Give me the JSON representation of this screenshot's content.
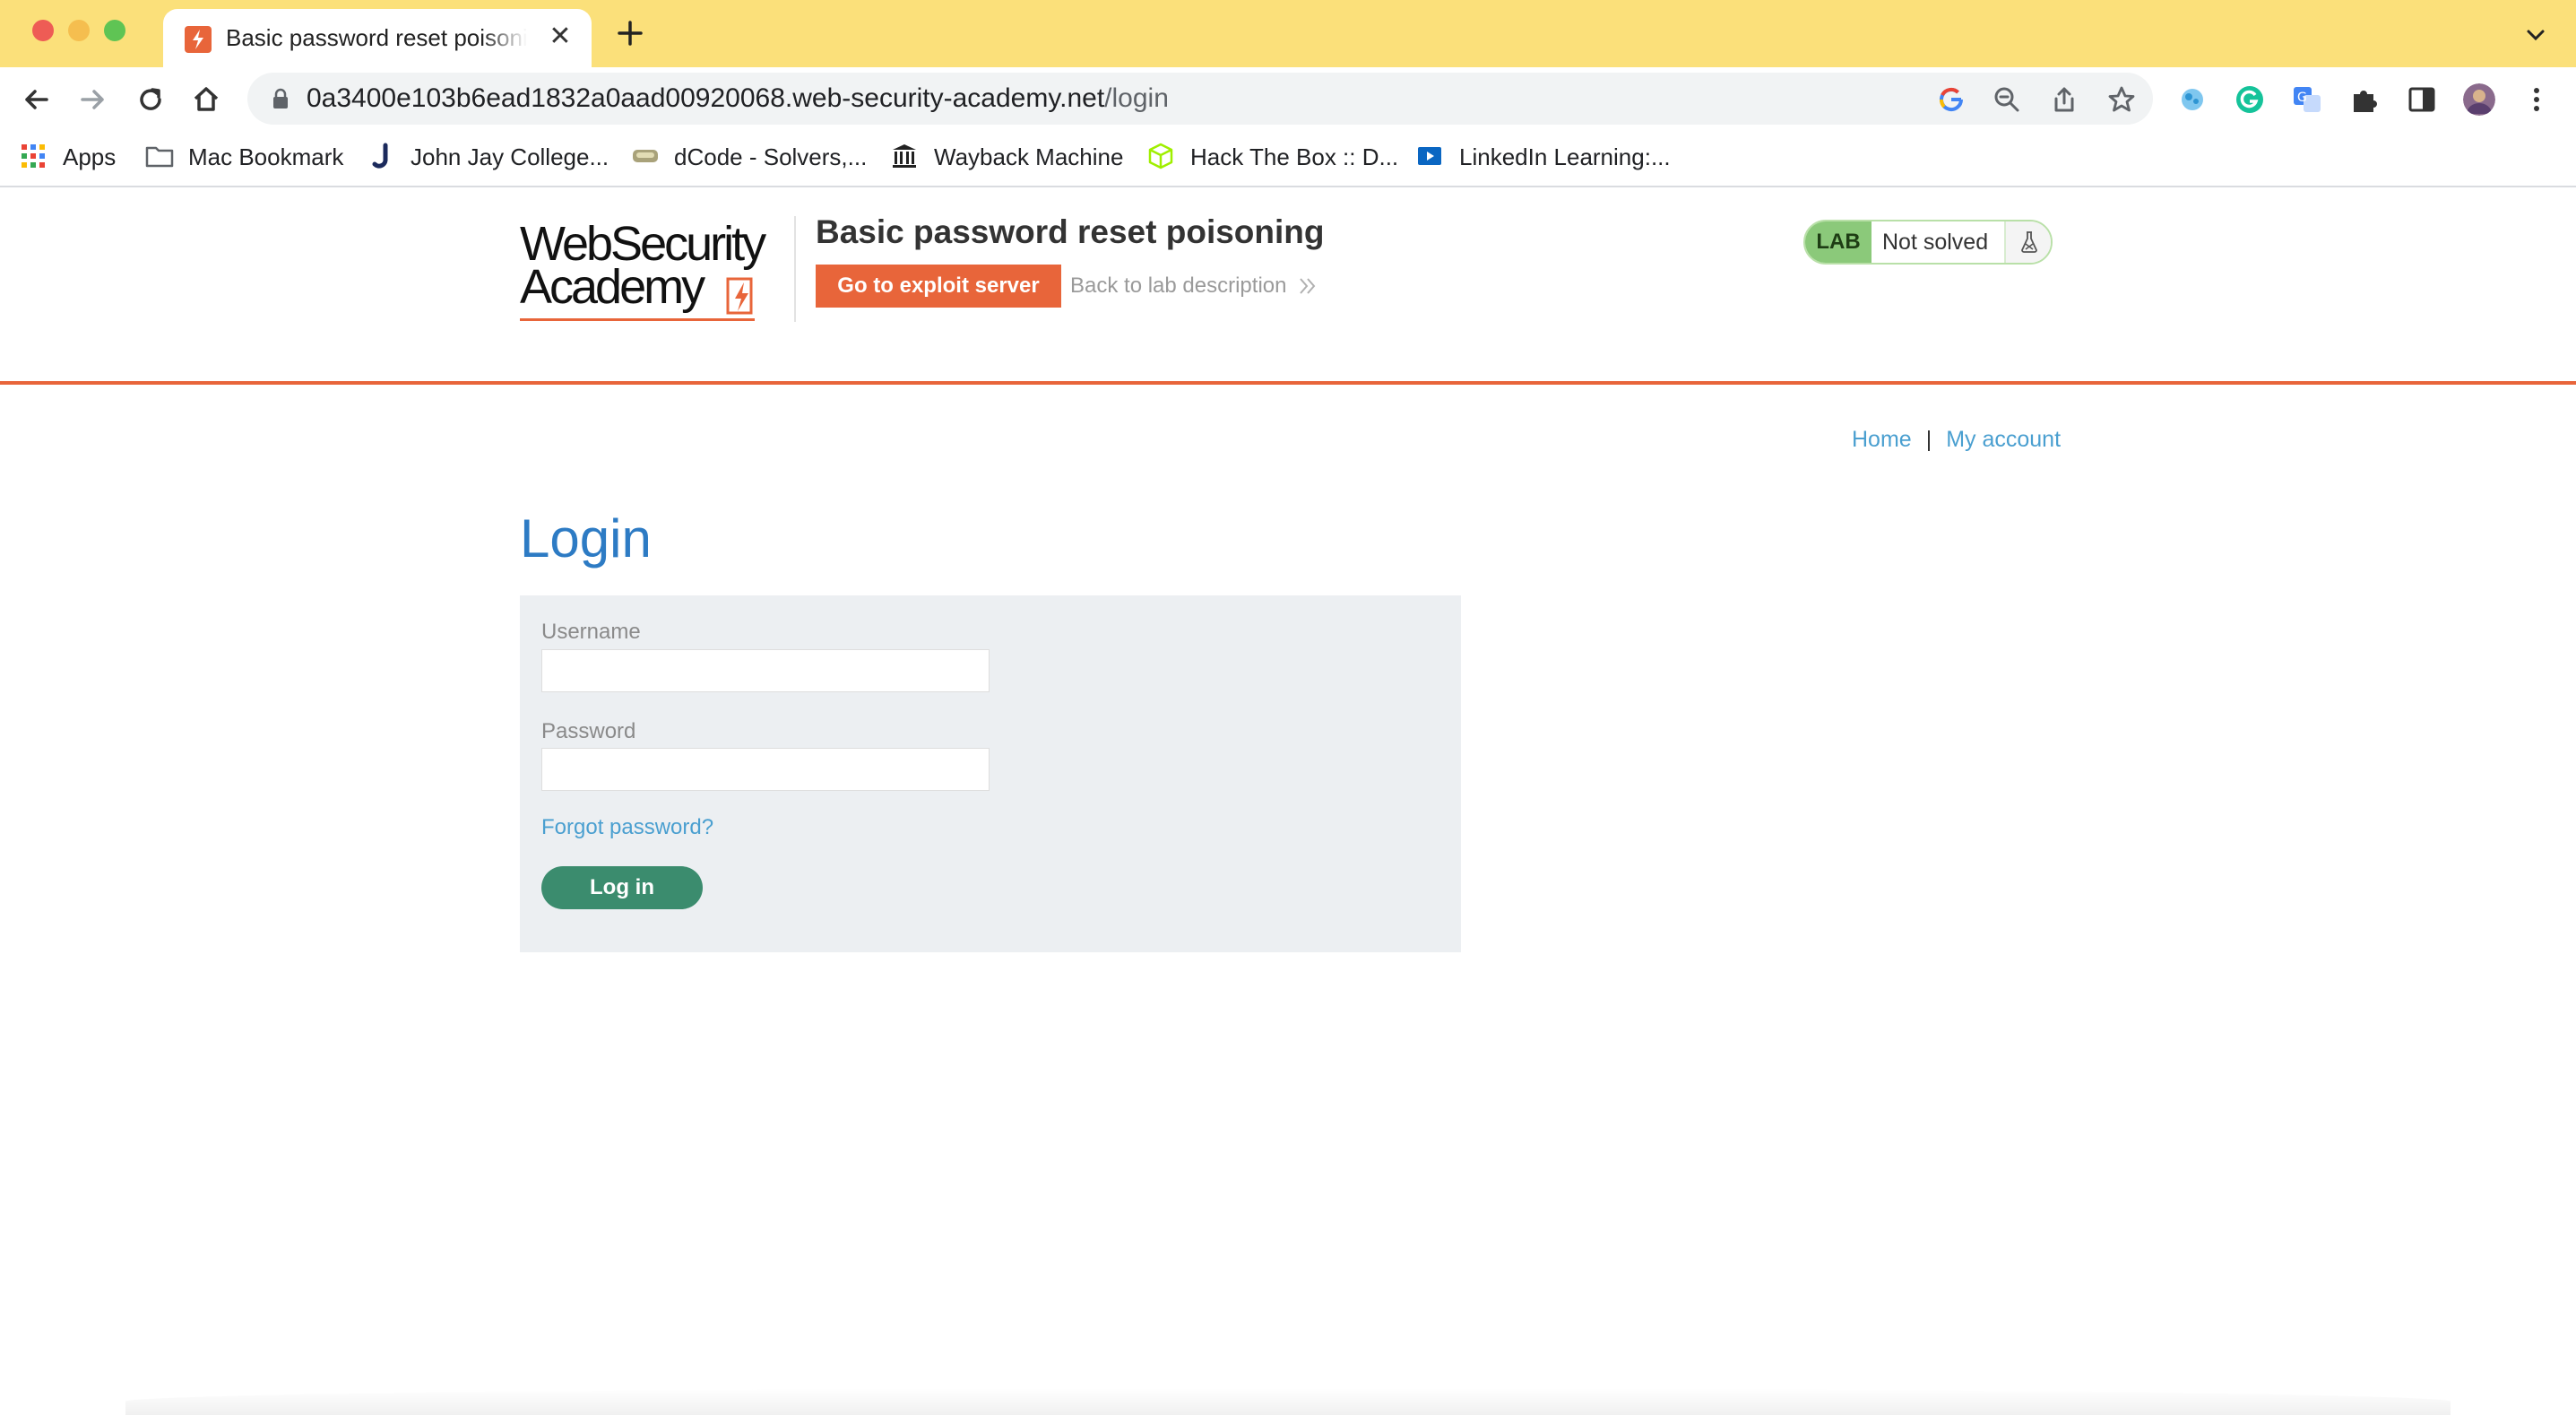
{
  "browser": {
    "tab_title": "Basic password reset poisoning",
    "tab_close": "✕",
    "url_host": "0a3400e103b6ead1832a0aad00920068.web-security-academy.net",
    "url_path": "/login",
    "bookmarks": [
      {
        "label": "Apps",
        "icon": "apps-grid-icon"
      },
      {
        "label": "Mac Bookmark",
        "icon": "folder-icon"
      },
      {
        "label": "John Jay College...",
        "icon": "john-jay-icon"
      },
      {
        "label": "dCode - Solvers,...",
        "icon": "dcode-icon"
      },
      {
        "label": "Wayback Machine",
        "icon": "wayback-icon"
      },
      {
        "label": "Hack The Box :: D...",
        "icon": "hackthebox-icon"
      },
      {
        "label": "LinkedIn Learning:...",
        "icon": "linkedin-learning-icon"
      }
    ]
  },
  "header": {
    "logo_line1": "WebSecurity",
    "logo_line2": "Academy",
    "lab_title": "Basic password reset poisoning",
    "exploit_button": "Go to exploit server",
    "back_link": "Back to lab description",
    "lab_badge": "LAB",
    "lab_status": "Not solved"
  },
  "nav": {
    "home": "Home",
    "separator": "|",
    "my_account": "My account"
  },
  "login": {
    "heading": "Login",
    "username_label": "Username",
    "username_value": "",
    "password_label": "Password",
    "password_value": "",
    "forgot_link": "Forgot password?",
    "submit": "Log in"
  },
  "colors": {
    "tabstrip": "#fbe07a",
    "brand_orange": "#e8653a",
    "heading_blue": "#2d7bc4",
    "link_blue": "#4a9fd0",
    "button_green": "#3b8c6e",
    "lab_green": "#8bc97a"
  }
}
